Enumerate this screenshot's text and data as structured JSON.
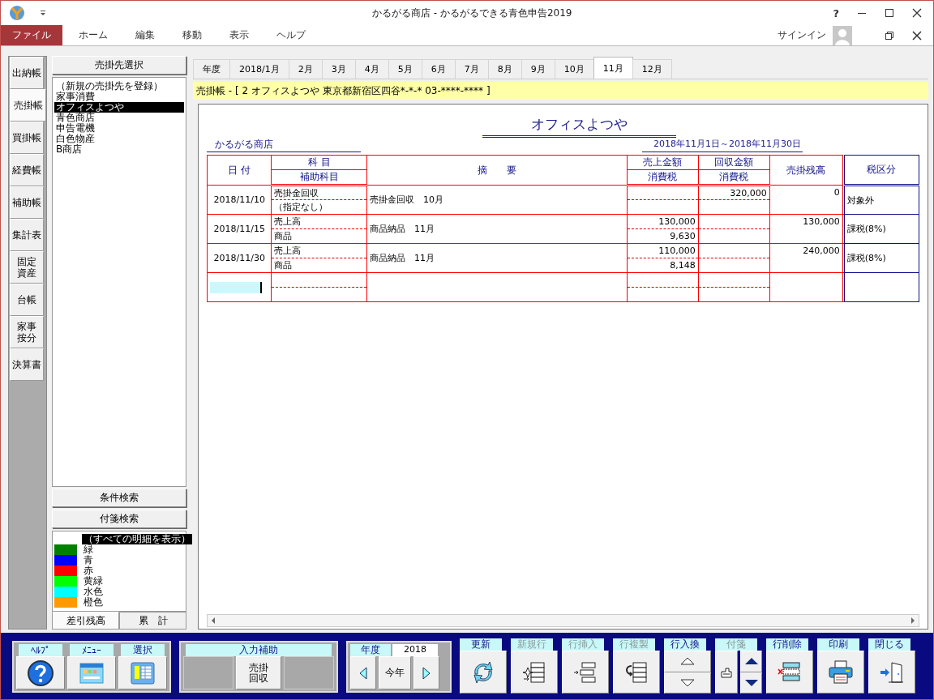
{
  "window": {
    "title": "かるがる商店 - かるがるできる青色申告2019",
    "help": "?"
  },
  "menu": [
    {
      "label": "ファイル",
      "selected": true
    },
    {
      "label": "ホーム",
      "selected": false
    },
    {
      "label": "編集",
      "selected": false
    },
    {
      "label": "移動",
      "selected": false
    },
    {
      "label": "表示",
      "selected": false
    },
    {
      "label": "ヘルプ",
      "selected": false
    }
  ],
  "account": {
    "signin": "サインイン"
  },
  "side_tabs": [
    {
      "label": "出納帳",
      "selected": false
    },
    {
      "label": "売掛帳",
      "selected": true
    },
    {
      "label": "買掛帳",
      "selected": false
    },
    {
      "label": "経費帳",
      "selected": false
    },
    {
      "label": "補助帳",
      "selected": false
    },
    {
      "label": "集計表",
      "selected": false
    },
    {
      "label": "固定資産",
      "selected": false
    },
    {
      "label": "台帳",
      "selected": false
    },
    {
      "label": "家事按分",
      "selected": false
    },
    {
      "label": "決算書",
      "selected": false
    }
  ],
  "customer_panel": {
    "header": "売掛先選択",
    "items": [
      {
        "label": "（新規の売掛先を登録）",
        "selected": false
      },
      {
        "label": "家事消費",
        "selected": false
      },
      {
        "label": "オフィスよつや",
        "selected": true
      },
      {
        "label": "青色商店",
        "selected": false
      },
      {
        "label": "申告電機",
        "selected": false
      },
      {
        "label": "白色物産",
        "selected": false
      },
      {
        "label": "B商店",
        "selected": false
      }
    ],
    "buttons": [
      "条件検索",
      "付箋検索"
    ],
    "tags": [
      {
        "label": "（すべての明細を表示）",
        "selected": true
      },
      {
        "label": "緑",
        "color": "#008000",
        "selected": false
      },
      {
        "label": "青",
        "color": "#0000ff",
        "selected": false
      },
      {
        "label": "赤",
        "color": "#ff0000",
        "selected": false
      },
      {
        "label": "黄緑",
        "color": "#00ff00",
        "selected": false
      },
      {
        "label": "水色",
        "color": "#00ffff",
        "selected": false
      },
      {
        "label": "橙色",
        "color": "#ff9900",
        "selected": false
      }
    ],
    "bottom_tabs": [
      {
        "label": "差引残高",
        "selected": true
      },
      {
        "label": "累　計",
        "selected": false
      }
    ]
  },
  "month_tabs": [
    {
      "label": "年度",
      "selected": false
    },
    {
      "label": "2018/1月",
      "selected": false
    },
    {
      "label": "2月",
      "selected": false
    },
    {
      "label": "3月",
      "selected": false
    },
    {
      "label": "4月",
      "selected": false
    },
    {
      "label": "5月",
      "selected": false
    },
    {
      "label": "6月",
      "selected": false
    },
    {
      "label": "7月",
      "selected": false
    },
    {
      "label": "8月",
      "selected": false
    },
    {
      "label": "9月",
      "selected": false
    },
    {
      "label": "10月",
      "selected": false
    },
    {
      "label": "11月",
      "selected": true
    },
    {
      "label": "12月",
      "selected": false
    }
  ],
  "ledger": {
    "banner": "売掛帳 - [ 2 オフィスよつや 東京都新宿区四谷*-*-* 03-****-**** ]",
    "title": "オフィスよつや",
    "company": "かるがる商店",
    "period": "2018年11月1日～2018年11月30日",
    "columns": {
      "date": "日 付",
      "account": "科 目",
      "sub_account": "補助科目",
      "description": "摘　　要",
      "sales": "売上金額",
      "sales_tax": "消費税",
      "collected": "回収金額",
      "collected_tax": "消費税",
      "balance": "売掛残高",
      "tax_class": "税区分"
    },
    "rows": [
      {
        "date": "2018/11/10",
        "account": "売掛金回収",
        "sub_account": "（指定なし）",
        "description": "売掛金回収　10月",
        "collected": "320,000",
        "balance": "0",
        "tax_class": "対象外"
      },
      {
        "date": "2018/11/15",
        "account": "売上高",
        "sub_account": "商品",
        "description": "商品納品　11月",
        "sales": "130,000",
        "sales_tax": "9,630",
        "balance": "130,000",
        "tax_class": "課税(8%)"
      },
      {
        "date": "2018/11/30",
        "account": "売上高",
        "sub_account": "商品",
        "description": "商品納品　11月",
        "sales": "110,000",
        "sales_tax": "8,148",
        "balance": "240,000",
        "tax_class": "課税(8%)"
      }
    ],
    "entry_row": {
      "focused": true
    }
  },
  "toolbar": {
    "nav": [
      {
        "label": "ﾍﾙﾌﾟ",
        "kind": "help"
      },
      {
        "label": "ﾒﾆｭｰ",
        "kind": "menu"
      },
      {
        "label": "選択",
        "kind": "select"
      }
    ],
    "input_assist": {
      "label": "入力補助",
      "slots": [
        {
          "kind": "empty"
        },
        {
          "kind": "text",
          "label": "売掛回収"
        },
        {
          "kind": "empty"
        }
      ]
    },
    "year": {
      "label": "年度",
      "value": "2018",
      "today": "今年"
    },
    "actions": [
      {
        "label": "更新",
        "kind": "refresh",
        "disabled": false
      },
      {
        "label": "新規行",
        "kind": "new-row",
        "disabled": true
      },
      {
        "label": "行挿入",
        "kind": "insert-row",
        "disabled": true
      },
      {
        "label": "行複製",
        "kind": "copy-row",
        "disabled": true
      },
      {
        "label": "行入換",
        "kind": "swap",
        "disabled": false
      },
      {
        "label": "付箋",
        "kind": "tag",
        "disabled": true
      },
      {
        "label": "行削除",
        "kind": "delete-row",
        "disabled": false
      },
      {
        "label": "印刷",
        "kind": "print",
        "disabled": false
      },
      {
        "label": "閉じる",
        "kind": "close",
        "disabled": false
      }
    ]
  }
}
